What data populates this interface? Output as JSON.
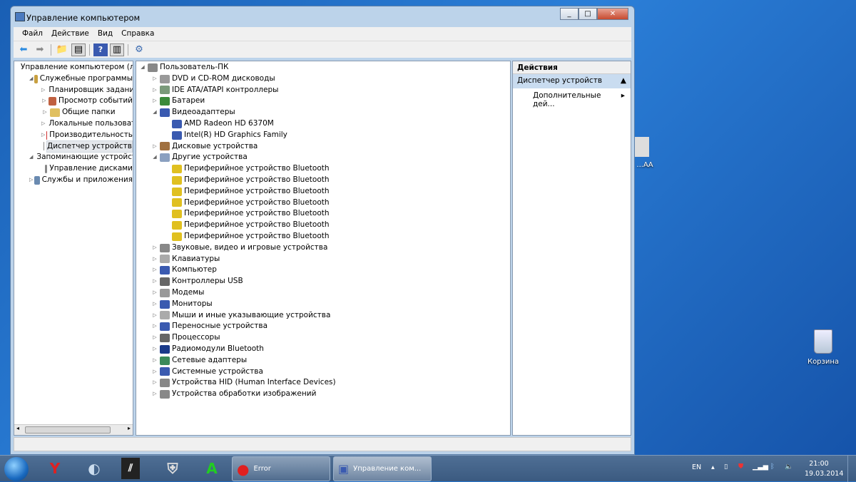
{
  "window": {
    "title": "Управление компьютером"
  },
  "menu": [
    "Файл",
    "Действие",
    "Вид",
    "Справка"
  ],
  "left_tree": [
    {
      "label": "Управление компьютером (л",
      "level": 0,
      "exp": "",
      "color": "#4a7ac0"
    },
    {
      "label": "Служебные программы",
      "level": 1,
      "exp": "◢",
      "color": "#c8a040"
    },
    {
      "label": "Планировщик заданий",
      "level": 2,
      "exp": "▷",
      "color": "#bbb"
    },
    {
      "label": "Просмотр событий",
      "level": 2,
      "exp": "▷",
      "color": "#c06040"
    },
    {
      "label": "Общие папки",
      "level": 2,
      "exp": "▷",
      "color": "#e0c060"
    },
    {
      "label": "Локальные пользовате",
      "level": 2,
      "exp": "▷",
      "color": "#5080c0"
    },
    {
      "label": "Производительность",
      "level": 2,
      "exp": "▷",
      "color": "#d03030"
    },
    {
      "label": "Диспетчер устройств",
      "level": 2,
      "exp": "",
      "color": "#888",
      "selected": true
    },
    {
      "label": "Запоминающие устройст",
      "level": 1,
      "exp": "◢",
      "color": "#6a8ab0"
    },
    {
      "label": "Управление дисками",
      "level": 2,
      "exp": "",
      "color": "#888"
    },
    {
      "label": "Службы и приложения",
      "level": 1,
      "exp": "▷",
      "color": "#6a8ab0"
    }
  ],
  "device_tree": [
    {
      "label": "Пользователь-ПК",
      "level": 0,
      "exp": "◢",
      "color": "#888"
    },
    {
      "label": "DVD и CD-ROM дисководы",
      "level": 1,
      "exp": "▷",
      "color": "#999"
    },
    {
      "label": "IDE ATA/ATAPI контроллеры",
      "level": 1,
      "exp": "▷",
      "color": "#7a9a7a"
    },
    {
      "label": "Батареи",
      "level": 1,
      "exp": "▷",
      "color": "#3a8a3a"
    },
    {
      "label": "Видеоадаптеры",
      "level": 1,
      "exp": "◢",
      "color": "#3a5ab0"
    },
    {
      "label": "AMD Radeon HD 6370M",
      "level": 2,
      "exp": "",
      "color": "#3a5ab0"
    },
    {
      "label": "Intel(R) HD Graphics Family",
      "level": 2,
      "exp": "",
      "color": "#3a5ab0"
    },
    {
      "label": "Дисковые устройства",
      "level": 1,
      "exp": "▷",
      "color": "#a07040"
    },
    {
      "label": "Другие устройства",
      "level": 1,
      "exp": "◢",
      "color": "#8aa0c0"
    },
    {
      "label": "Периферийное устройство Bluetooth",
      "level": 2,
      "exp": "",
      "color": "#e0c020"
    },
    {
      "label": "Периферийное устройство Bluetooth",
      "level": 2,
      "exp": "",
      "color": "#e0c020"
    },
    {
      "label": "Периферийное устройство Bluetooth",
      "level": 2,
      "exp": "",
      "color": "#e0c020"
    },
    {
      "label": "Периферийное устройство Bluetooth",
      "level": 2,
      "exp": "",
      "color": "#e0c020"
    },
    {
      "label": "Периферийное устройство Bluetooth",
      "level": 2,
      "exp": "",
      "color": "#e0c020"
    },
    {
      "label": "Периферийное устройство Bluetooth",
      "level": 2,
      "exp": "",
      "color": "#e0c020"
    },
    {
      "label": "Периферийное устройство Bluetooth",
      "level": 2,
      "exp": "",
      "color": "#e0c020"
    },
    {
      "label": "Звуковые, видео и игровые устройства",
      "level": 1,
      "exp": "▷",
      "color": "#888"
    },
    {
      "label": "Клавиатуры",
      "level": 1,
      "exp": "▷",
      "color": "#aaa"
    },
    {
      "label": "Компьютер",
      "level": 1,
      "exp": "▷",
      "color": "#3a5ab0"
    },
    {
      "label": "Контроллеры USB",
      "level": 1,
      "exp": "▷",
      "color": "#666"
    },
    {
      "label": "Модемы",
      "level": 1,
      "exp": "▷",
      "color": "#999"
    },
    {
      "label": "Мониторы",
      "level": 1,
      "exp": "▷",
      "color": "#3a5ab0"
    },
    {
      "label": "Мыши и иные указывающие устройства",
      "level": 1,
      "exp": "▷",
      "color": "#aaa"
    },
    {
      "label": "Переносные устройства",
      "level": 1,
      "exp": "▷",
      "color": "#3a5ab0"
    },
    {
      "label": "Процессоры",
      "level": 1,
      "exp": "▷",
      "color": "#666"
    },
    {
      "label": "Радиомодули Bluetooth",
      "level": 1,
      "exp": "▷",
      "color": "#1a3a8a"
    },
    {
      "label": "Сетевые адаптеры",
      "level": 1,
      "exp": "▷",
      "color": "#3a8a5a"
    },
    {
      "label": "Системные устройства",
      "level": 1,
      "exp": "▷",
      "color": "#3a5ab0"
    },
    {
      "label": "Устройства HID (Human Interface Devices)",
      "level": 1,
      "exp": "▷",
      "color": "#888"
    },
    {
      "label": "Устройства обработки изображений",
      "level": 1,
      "exp": "▷",
      "color": "#888"
    }
  ],
  "actions": {
    "header": "Действия",
    "section": "Диспетчер устройств",
    "item": "Дополнительные дей..."
  },
  "taskbar": {
    "tasks": [
      "Error",
      "Управление ком..."
    ],
    "lang": "EN",
    "time": "21:00",
    "date": "19.03.2014"
  },
  "desktop": {
    "recycle_bin": "Корзина",
    "partial_icon": "...АА"
  }
}
